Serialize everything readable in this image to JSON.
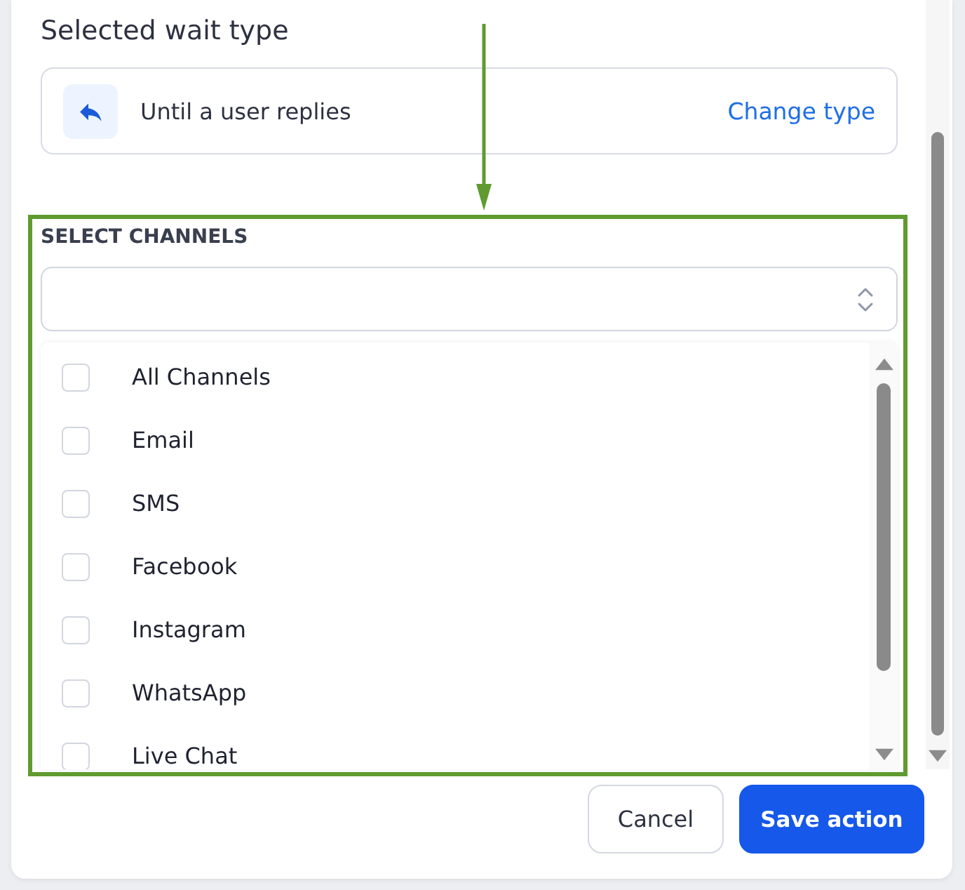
{
  "section_title": "Selected wait type",
  "wait_type": {
    "label": "Until a user replies",
    "action": "Change type"
  },
  "channels": {
    "label": "SELECT CHANNELS",
    "options": [
      {
        "label": "All Channels",
        "checked": false
      },
      {
        "label": "Email",
        "checked": false
      },
      {
        "label": "SMS",
        "checked": false
      },
      {
        "label": "Facebook",
        "checked": false
      },
      {
        "label": "Instagram",
        "checked": false
      },
      {
        "label": "WhatsApp",
        "checked": false
      },
      {
        "label": "Live Chat",
        "checked": false
      }
    ]
  },
  "buttons": [
    {
      "label": "Cancel",
      "kind": "secondary"
    },
    {
      "label": "Save action",
      "kind": "primary"
    }
  ]
}
